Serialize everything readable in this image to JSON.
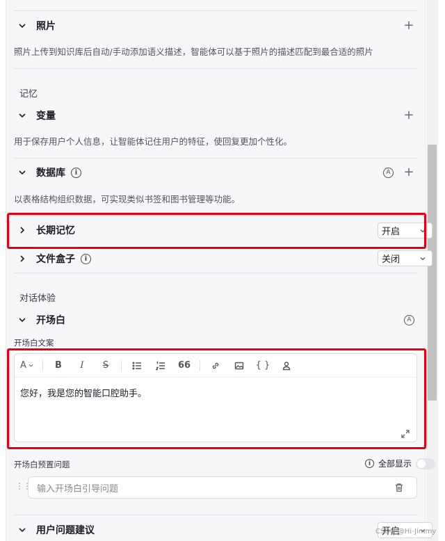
{
  "photos": {
    "title": "照片",
    "desc": "照片上传到知识库后自动/手动添加语义描述，智能体可以基于照片的描述匹配到最合适的照片"
  },
  "memory": {
    "group_label": "记忆",
    "variables": {
      "title": "变量",
      "desc": "用于保存用户个人信息，让智能体记住用户的特征，使回复更加个性化。"
    },
    "database": {
      "title": "数据库",
      "desc": "以表格结构组织数据，可实现类似书签和图书管理等功能。"
    },
    "long_term": {
      "title": "长期记忆",
      "select_value": "开启"
    },
    "file_box": {
      "title": "文件盒子",
      "select_value": "关闭"
    }
  },
  "dialog": {
    "group_label": "对话体验",
    "opening": {
      "title": "开场白",
      "copy_label": "开场白文案",
      "content": "您好，我是您的智能口腔助手。",
      "toolbar": {
        "font": "A",
        "bold": "B",
        "italic": "I",
        "strike": "S",
        "quote": "66",
        "code": "{ }"
      },
      "preset_label": "开场白预置问题",
      "show_all_label": "全部显示",
      "question_placeholder": "输入开场白引导问题"
    },
    "suggestions": {
      "title": "用户问题建议",
      "select_value": "开启"
    }
  },
  "icons": {
    "plus": "+",
    "info": "i",
    "auto": "A"
  },
  "watermark": "CSDN @Hi-Jimmy",
  "colors": {
    "highlight": "#e60012",
    "panel_bg": "#f7f7fa"
  }
}
